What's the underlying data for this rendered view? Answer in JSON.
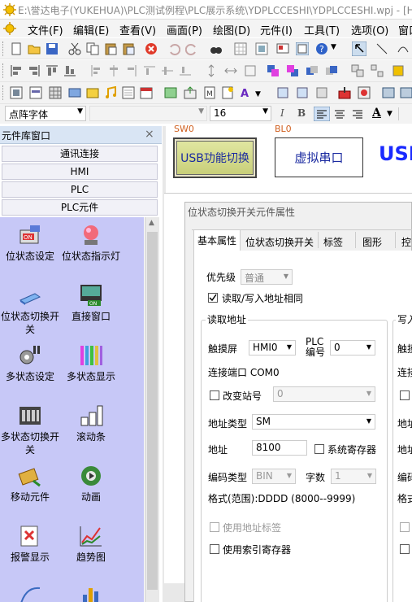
{
  "window": {
    "title": "E:\\誉达电子(YUKEHUA)\\PLC测试例程\\PLC展示系统\\YDPLCCESHI\\YDPLCCESHI.wpj - [HM"
  },
  "menu": [
    "文件(F)",
    "编辑(E)",
    "查看(V)",
    "画面(P)",
    "绘图(D)",
    "元件(I)",
    "工具(T)",
    "选项(O)",
    "窗口"
  ],
  "fontbar": {
    "font_name": "点阵字体",
    "font_size": "16",
    "italic": "I",
    "bold": "B",
    "underline": "A"
  },
  "library": {
    "title": "元件库窗口",
    "close": "×",
    "categories": [
      "通讯连接",
      "HMI",
      "PLC",
      "PLC元件"
    ],
    "items": [
      {
        "label": "位状态设定",
        "icon": "bit-set-icon"
      },
      {
        "label": "位状态指示灯",
        "icon": "indicator-lamp-icon"
      },
      {
        "label": "位状态切换开关",
        "icon": "toggle-switch-icon"
      },
      {
        "label": "直接窗口",
        "icon": "direct-window-icon"
      },
      {
        "label": "多状态设定",
        "icon": "multi-state-set-icon"
      },
      {
        "label": "多状态显示",
        "icon": "multi-state-display-icon"
      },
      {
        "label": "多状态切换开关",
        "icon": "multi-state-switch-icon"
      },
      {
        "label": "滚动条",
        "icon": "scroll-bar-icon"
      },
      {
        "label": "移动元件",
        "icon": "move-element-icon"
      },
      {
        "label": "动画",
        "icon": "animation-icon"
      },
      {
        "label": "报警显示",
        "icon": "alarm-display-icon"
      },
      {
        "label": "趋势图",
        "icon": "trend-chart-icon"
      }
    ]
  },
  "canvas": {
    "sw_label": "SW0",
    "bl_label": "BL0",
    "usb_button": "USB功能切换",
    "virtual_port": "虚拟串口",
    "usb_text": "USB"
  },
  "dialog": {
    "title": "位状态切换开关元件属性",
    "tabs": [
      "基本属性",
      "位状态切换开关",
      "标签",
      "图形",
      "控"
    ],
    "priority_label": "优先级",
    "priority_value": "普通",
    "same_addr_label": "读取/写入地址相同",
    "read_group": "读取地址",
    "write_group": "写入",
    "touch_label": "触摸屏",
    "touch_value": "HMI0",
    "plc_no_label": "PLC编号",
    "plc_no_value": "0",
    "port_label": "连接端口 COM0",
    "change_station": "改变站号",
    "station_value": "0",
    "addr_type_label": "地址类型",
    "addr_type_value": "SM",
    "addr_label": "地址",
    "addr_value": "8100",
    "sys_reg": "系统寄存器",
    "code_type_label": "编码类型",
    "code_type_value": "BIN",
    "digits_label": "字数",
    "digits_value": "1",
    "format": "格式(范围):DDDD (8000--9999)",
    "use_addr_tag": "使用地址标签",
    "use_index_reg": "使用索引寄存器",
    "right_touch": "触摸",
    "right_port": "连接",
    "right_addr_type": "地址",
    "right_addr": "地址",
    "right_code": "编码",
    "right_format": "格式"
  }
}
